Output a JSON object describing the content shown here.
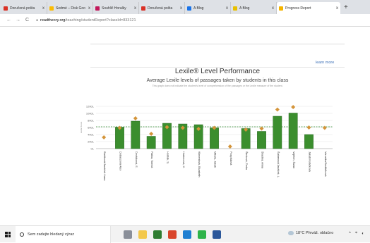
{
  "browser": {
    "tabs": [
      {
        "title": "Doručená pošta",
        "color": "#d93025",
        "active": false
      },
      {
        "title": "Sedmé – Disk Goo",
        "color": "#fbbc04",
        "active": false
      },
      {
        "title": "Souhlič Horalky",
        "color": "#c2185b",
        "active": false
      },
      {
        "title": "Doručená pošta",
        "color": "#d93025",
        "active": false
      },
      {
        "title": "A Blog",
        "color": "#1a73e8",
        "active": false
      },
      {
        "title": "A Blog",
        "color": "#e8c000",
        "active": false
      },
      {
        "title": "Progress Report",
        "color": "#f5b400",
        "active": true
      }
    ],
    "new_tab": "+",
    "close": "x",
    "back": "←",
    "forward": "→",
    "reload": "C",
    "lock": "🔒",
    "url_domain": "readtheory.org",
    "url_path": "/teaching/studentReport?classId=833121"
  },
  "page": {
    "learn_more": "learn more",
    "title": "Lexile® Level Performance",
    "subtitle": "Average Lexile levels of passages taken by students in this class",
    "note": "This graph does not indicate the student's level of comprehension of the passages or the Lexile measure of the student."
  },
  "chart_data": {
    "type": "bar",
    "ylim": [
      0,
      1200
    ],
    "yticks": [
      "1200L",
      "1000L",
      "800L",
      "600L",
      "400L",
      "200L",
      "0L"
    ],
    "ylabel": "Lexile Score",
    "bar_color": "#3b8e2e",
    "marker_color": "#d4943a",
    "categories": [
      "Bártíková/Janáček Hana",
      "Dobaszová Alex",
      "Dvořáková, E.",
      "Fialka, Tomáš",
      "Horňák, S.",
      "Hrubecová, K.",
      "Klimentová, Elizabeth",
      "Mikula, Jakub",
      "Pospíšilová",
      "Šimková, Terka",
      "Šťastná, Anna",
      "Šutnerová/Janáček, L.",
      "Vojtěch, Šulan",
      "Jakub/Koláčková",
      "Veronika/Sedláčková"
    ],
    "values": [
      0,
      610,
      780,
      350,
      720,
      700,
      680,
      590,
      0,
      570,
      490,
      920,
      1010,
      400,
      0
    ],
    "markers": [
      320,
      590,
      860,
      420,
      610,
      590,
      560,
      590,
      60,
      540,
      570,
      1110,
      1180,
      600,
      590
    ],
    "average_line": 620
  },
  "taskbar": {
    "search_placeholder": "Sem zadejte hledaný výraz",
    "weather": "18°C  Převáž. oblačno",
    "tray": [
      "^",
      "⌖",
      "◐"
    ]
  }
}
